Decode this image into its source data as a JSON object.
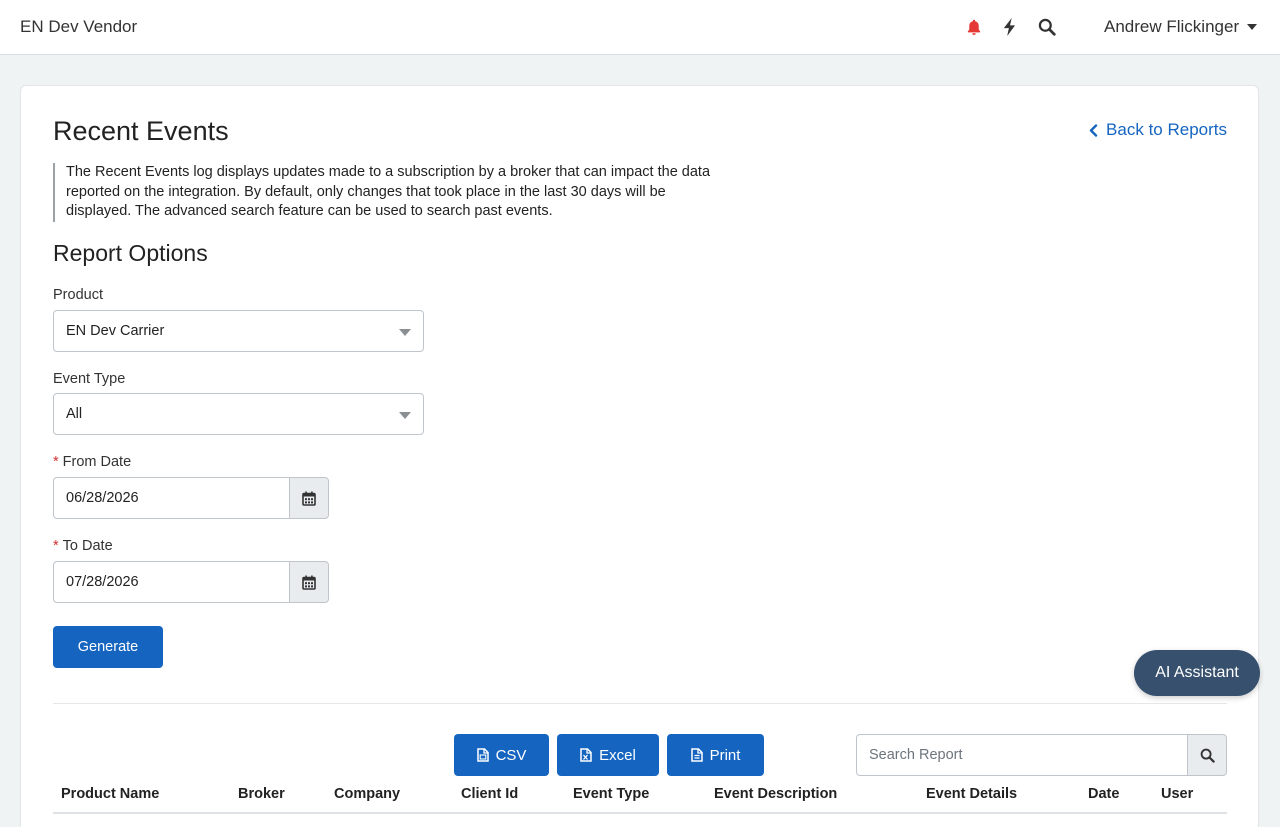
{
  "header": {
    "brand": "EN Dev Vendor",
    "user_name": "Andrew Flickinger",
    "icons": [
      "bell-icon",
      "bolt-icon",
      "search-icon"
    ],
    "bell_color": "#e53935"
  },
  "page": {
    "title": "Recent Events",
    "back_link": "Back to Reports",
    "description": "The Recent Events log displays updates made to a subscription by a broker that can impact the data reported on the integration. By default, only changes that took place in the last 30 days will be displayed. The advanced search feature can be used to search past events."
  },
  "report_options": {
    "title": "Report Options",
    "product_label": "Product",
    "product_value": "EN Dev Carrier",
    "event_type_label": "Event Type",
    "event_type_value": "All",
    "required_mark": "*",
    "from_date_label": "From Date",
    "from_date_value": "06/28/2026",
    "to_date_label": "To Date",
    "to_date_value": "07/28/2026",
    "generate_label": "Generate"
  },
  "toolbar": {
    "csv_label": "CSV",
    "excel_label": "Excel",
    "print_label": "Print",
    "search_placeholder": "Search Report"
  },
  "table": {
    "columns": [
      "Product Name",
      "Broker",
      "Company",
      "Client Id",
      "Event Type",
      "Event Description",
      "Event Details",
      "Date",
      "User"
    ]
  },
  "ai_assistant": {
    "label": "AI Assistant"
  },
  "colors": {
    "primary": "#1565c0",
    "ai_button": "#37506e",
    "background": "#f0f3f4"
  }
}
